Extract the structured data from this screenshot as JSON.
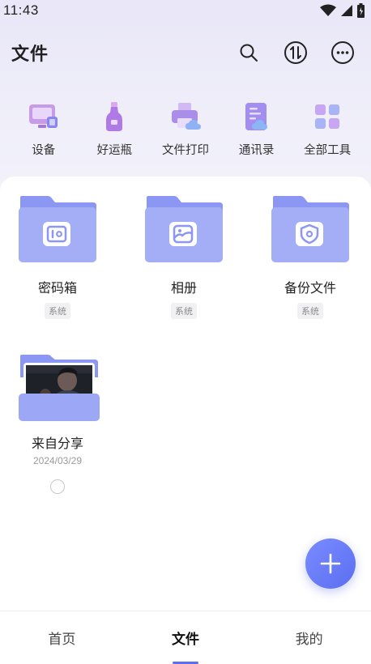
{
  "status_bar": {
    "time": "11:43",
    "icons": [
      "wifi-icon",
      "signal-icon",
      "battery-icon"
    ]
  },
  "header": {
    "title": "文件",
    "actions": [
      "search-icon",
      "transfer-icon",
      "more-icon"
    ]
  },
  "quick_actions": [
    {
      "label": "设备",
      "icon": "device-icon"
    },
    {
      "label": "好运瓶",
      "icon": "bottle-icon"
    },
    {
      "label": "文件打印",
      "icon": "printer-icon"
    },
    {
      "label": "通讯录",
      "icon": "contacts-icon"
    },
    {
      "label": "全部工具",
      "icon": "all-tools-icon"
    }
  ],
  "folders": [
    {
      "name": "密码箱",
      "tag": "系统",
      "icon": "safe-icon"
    },
    {
      "name": "相册",
      "tag": "系统",
      "icon": "album-icon"
    },
    {
      "name": "备份文件",
      "tag": "系统",
      "icon": "shield-icon"
    },
    {
      "name": "来自分享",
      "date": "2024/03/29",
      "icon": "shared-photo-thumbnail"
    }
  ],
  "tabs": [
    {
      "label": "首页",
      "active": false
    },
    {
      "label": "文件",
      "active": true
    },
    {
      "label": "我的",
      "active": false
    }
  ],
  "colors": {
    "accent": "#5b6ef0",
    "folder_back": "#8b97f2",
    "folder_front": "#a3aef7"
  }
}
